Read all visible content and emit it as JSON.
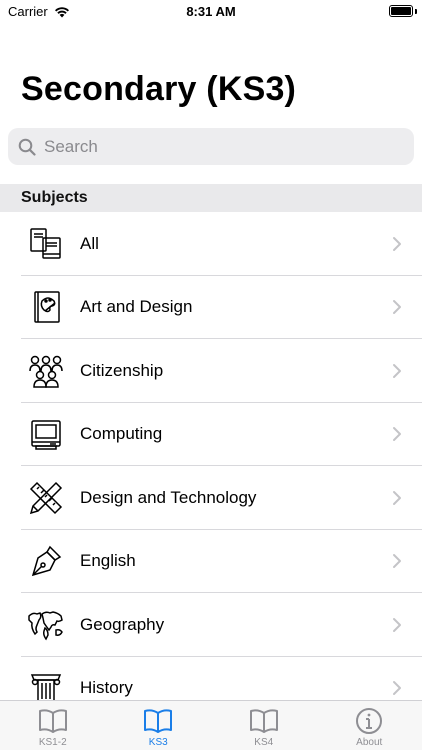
{
  "status_bar": {
    "carrier": "Carrier",
    "time": "8:31 AM"
  },
  "title": "Secondary (KS3)",
  "search": {
    "placeholder": "Search",
    "value": ""
  },
  "section": {
    "label": "Subjects"
  },
  "subjects": [
    {
      "label": "All",
      "icon": "books-icon"
    },
    {
      "label": "Art and Design",
      "icon": "palette-book-icon"
    },
    {
      "label": "Citizenship",
      "icon": "people-group-icon"
    },
    {
      "label": "Computing",
      "icon": "computer-icon"
    },
    {
      "label": "Design and Technology",
      "icon": "ruler-pencil-icon"
    },
    {
      "label": "English",
      "icon": "pen-nib-icon"
    },
    {
      "label": "Geography",
      "icon": "world-map-icon"
    },
    {
      "label": "History",
      "icon": "column-icon"
    }
  ],
  "tabs": [
    {
      "label": "KS1-2",
      "icon": "book-icon",
      "active": false
    },
    {
      "label": "KS3",
      "icon": "book-icon",
      "active": true
    },
    {
      "label": "KS4",
      "icon": "book-icon",
      "active": false
    },
    {
      "label": "About",
      "icon": "info-icon",
      "active": false
    }
  ],
  "colors": {
    "accent": "#1a7ee8",
    "inactive_tab": "#8e8e93"
  }
}
